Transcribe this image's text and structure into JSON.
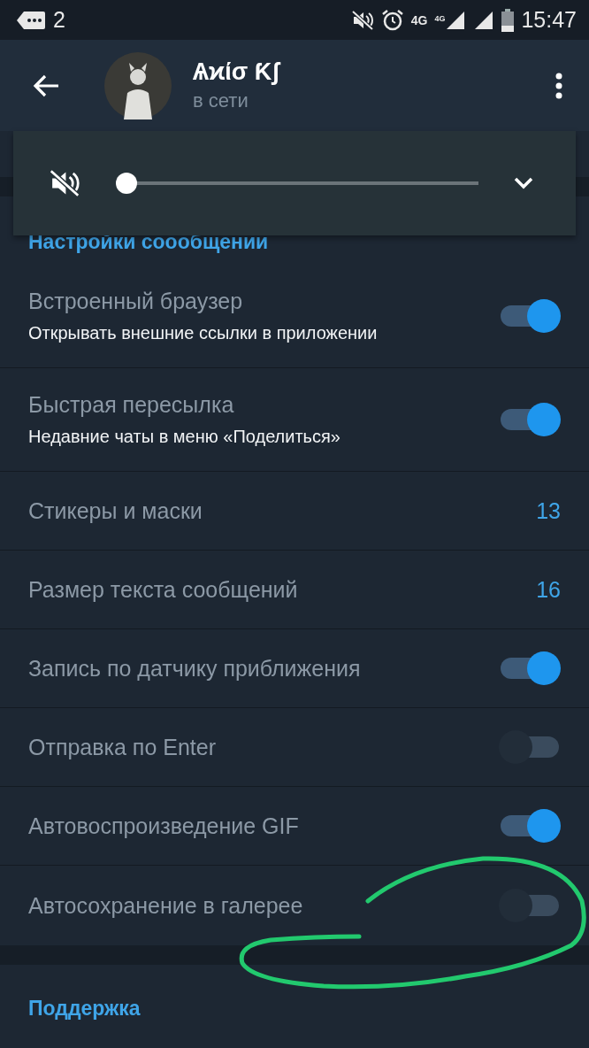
{
  "status_bar": {
    "notification_count": "2",
    "network_labels": [
      "4G",
      "4G"
    ],
    "time": "15:47"
  },
  "header": {
    "name": "Ѧϰίσ  Ƙʃ",
    "status": "в сети"
  },
  "volume_popup": {
    "muted": true,
    "level": 0
  },
  "section": {
    "title": "Настройки соообщении"
  },
  "rows": [
    {
      "kind": "toggle",
      "title": "Встроенный браузер",
      "subtitle": "Открывать внешние ссылки в приложении",
      "on": true
    },
    {
      "kind": "toggle",
      "title": "Быстрая пересылка",
      "subtitle": "Недавние чаты в меню «Поделиться»",
      "on": true
    },
    {
      "kind": "value",
      "title": "Стикеры и маски",
      "value": "13"
    },
    {
      "kind": "value",
      "title": "Размер текста сообщений",
      "value": "16"
    },
    {
      "kind": "toggle",
      "title": "Запись по датчику приближения",
      "on": true
    },
    {
      "kind": "toggle",
      "title": "Отправка по Enter",
      "on": false
    },
    {
      "kind": "toggle",
      "title": "Автовоспроизведение GIF",
      "on": true
    },
    {
      "kind": "toggle",
      "title": "Автосохранение в галерее",
      "on": false
    }
  ],
  "support_section": {
    "title": "Поддержка"
  }
}
